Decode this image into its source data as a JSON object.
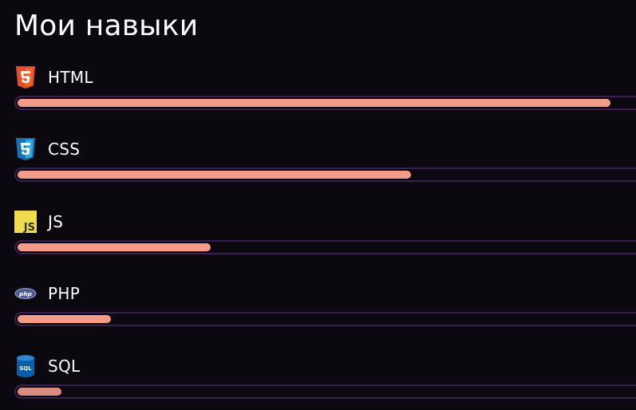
{
  "page": {
    "title": "Мои навыки"
  },
  "colors": {
    "background": "#0c080f",
    "track_border": "#3c1e4e",
    "bar_fill": "#f49c8a",
    "bar_fill_dim": "#d98d80"
  },
  "skills": [
    {
      "name": "HTML",
      "icon": "html5-icon",
      "level_percent": 95
    },
    {
      "name": "CSS",
      "icon": "css3-icon",
      "level_percent": 63
    },
    {
      "name": "JS",
      "icon": "js-icon",
      "level_percent": 31
    },
    {
      "name": "PHP",
      "icon": "php-icon",
      "level_percent": 15
    },
    {
      "name": "SQL",
      "icon": "sql-icon",
      "level_percent": 7
    }
  ]
}
